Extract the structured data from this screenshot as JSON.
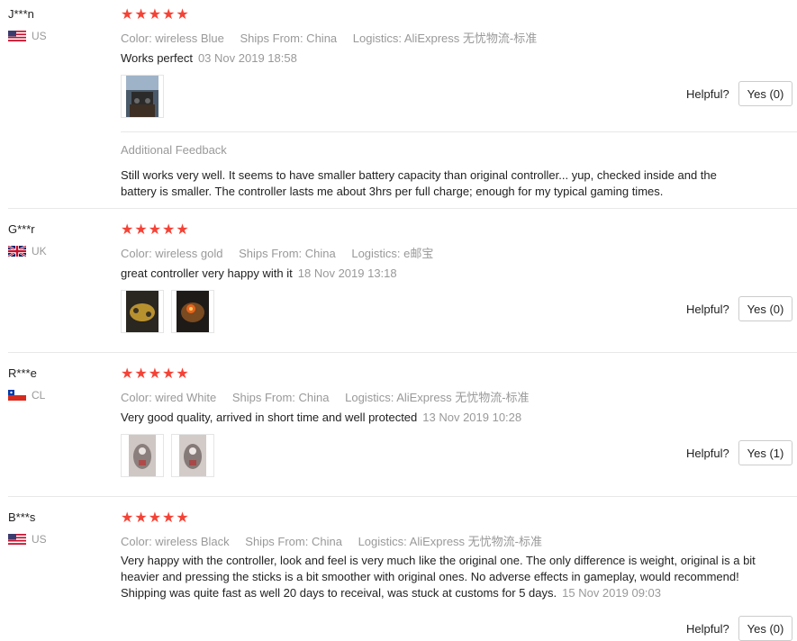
{
  "helpful_label": "Helpful?",
  "star_color": "#f44336",
  "reviews": [
    {
      "user": "J***n",
      "country": "US",
      "flag": "us-flag",
      "stars": "★★★★★",
      "color": "Color: wireless Blue",
      "ships": "Ships From: China",
      "logistics": "Logistics: AliExpress 无忧物流-标准",
      "text": "Works perfect",
      "date": "03 Nov 2019 18:58",
      "yes": "Yes (0)",
      "additional_label": "Additional Feedback",
      "additional_text": "Still works very well. It seems to have smaller battery capacity than original controller... yup, checked inside and the battery is smaller. The controller lasts me about 3hrs per full charge; enough for my typical gaming times."
    },
    {
      "user": "G***r",
      "country": "UK",
      "flag": "uk-flag",
      "stars": "★★★★★",
      "color": "Color: wireless gold",
      "ships": "Ships From: China",
      "logistics": "Logistics: e邮宝",
      "text": "great controller very happy with it",
      "date": "18 Nov 2019 13:18",
      "yes": "Yes (0)"
    },
    {
      "user": "R***e",
      "country": "CL",
      "flag": "cl-flag",
      "stars": "★★★★★",
      "color": "Color: wired White",
      "ships": "Ships From: China",
      "logistics": "Logistics: AliExpress 无忧物流-标准",
      "text": "Very good quality, arrived in short time and well protected",
      "date": "13 Nov 2019 10:28",
      "yes": "Yes (1)"
    },
    {
      "user": "B***s",
      "country": "US",
      "flag": "us-flag",
      "stars": "★★★★★",
      "color": "Color: wireless Black",
      "ships": "Ships From: China",
      "logistics": "Logistics: AliExpress 无忧物流-标准",
      "text": "Very happy with the controller, look and feel is very much like the original one. The only difference is weight, original is a bit heavier and pressing the sticks is a bit smoother with original ones. No adverse effects in gameplay, would recommend! Shipping was quite fast as well 20 days to receival, was stuck at customs for 5 days.",
      "date": "15 Nov 2019 09:03",
      "yes": "Yes (0)"
    }
  ]
}
